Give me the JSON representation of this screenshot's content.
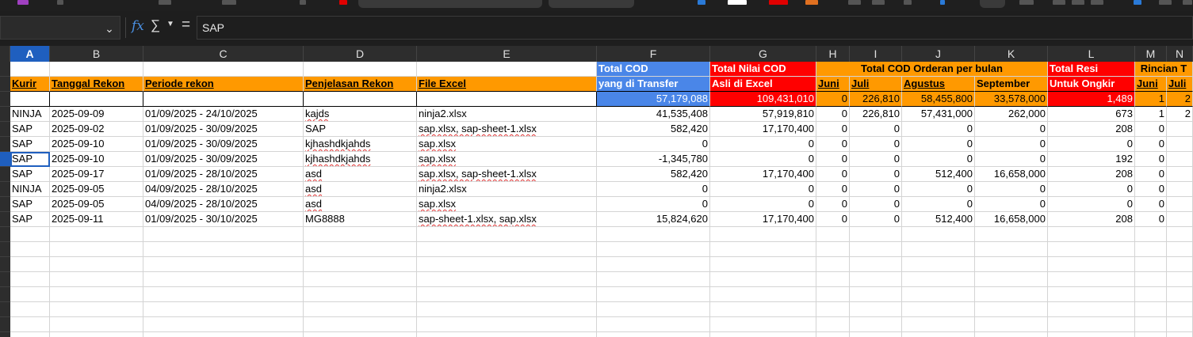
{
  "formula_bar": {
    "name_box_value": "",
    "formula_value": "SAP",
    "fx_icon": "fx-icon",
    "sum_icon": "sum-icon",
    "equals_icon": "equals-icon"
  },
  "columns": [
    "A",
    "B",
    "C",
    "D",
    "E",
    "F",
    "G",
    "H",
    "I",
    "J",
    "K",
    "L",
    "M",
    "N"
  ],
  "selected_column": "A",
  "header": {
    "row1": {
      "F": "Total COD",
      "G": "Total Nilai COD",
      "HK": "Total COD Orderan per bulan",
      "L": "Total Resi",
      "MN": "Rincian T"
    },
    "row2": {
      "A": "Kurir",
      "B": "Tanggal Rekon",
      "C": "Periode rekon",
      "D": "Penjelasan Rekon",
      "E": "File Excel",
      "F": "yang di Transfer",
      "G": "Asli di Excel",
      "H": "Juni",
      "I": "Juli",
      "J": "Agustus",
      "K": "September",
      "L": "Untuk Ongkir",
      "M": "Juni",
      "N": "Juli"
    }
  },
  "totals": {
    "F": "57,179,088",
    "G": "109,431,010",
    "H": "0",
    "I": "226,810",
    "J": "58,455,800",
    "K": "33,578,000",
    "L": "1,489",
    "M": "1",
    "N": "2"
  },
  "rows": [
    {
      "A": "NINJA",
      "B": "2025-09-09",
      "C": "01/09/2025 - 24/10/2025",
      "D": "kajds",
      "E": "ninja2.xlsx",
      "F": "41,535,408",
      "G": "57,919,810",
      "H": "0",
      "I": "226,810",
      "J": "57,431,000",
      "K": "262,000",
      "L": "673",
      "M": "1",
      "N": "2"
    },
    {
      "A": "SAP",
      "B": "2025-09-02",
      "C": "01/09/2025 - 30/09/2025",
      "D": "SAP",
      "E": "sap.xlsx, sap-sheet-1.xlsx",
      "F": "582,420",
      "G": "17,170,400",
      "H": "0",
      "I": "0",
      "J": "0",
      "K": "0",
      "L": "208",
      "M": "0",
      "N": ""
    },
    {
      "A": "SAP",
      "B": "2025-09-10",
      "C": "01/09/2025 - 30/09/2025",
      "D": "kjhashdkjahds",
      "E": "sap.xlsx",
      "F": "0",
      "G": "0",
      "H": "0",
      "I": "0",
      "J": "0",
      "K": "0",
      "L": "0",
      "M": "0",
      "N": ""
    },
    {
      "A": "SAP",
      "B": "2025-09-10",
      "C": "01/09/2025 - 30/09/2025",
      "D": "kjhashdkjahds",
      "E": "sap.xlsx",
      "F": "-1,345,780",
      "G": "0",
      "H": "0",
      "I": "0",
      "J": "0",
      "K": "0",
      "L": "192",
      "M": "0",
      "N": ""
    },
    {
      "A": "SAP",
      "B": "2025-09-17",
      "C": "01/09/2025 - 28/10/2025",
      "D": "asd",
      "E": "sap.xlsx, sap-sheet-1.xlsx",
      "F": "582,420",
      "G": "17,170,400",
      "H": "0",
      "I": "0",
      "J": "512,400",
      "K": "16,658,000",
      "L": "208",
      "M": "0",
      "N": ""
    },
    {
      "A": "NINJA",
      "B": "2025-09-05",
      "C": "04/09/2025 - 28/10/2025",
      "D": "asd",
      "E": "ninja2.xlsx",
      "F": "0",
      "G": "0",
      "H": "0",
      "I": "0",
      "J": "0",
      "K": "0",
      "L": "0",
      "M": "0",
      "N": ""
    },
    {
      "A": "SAP",
      "B": "2025-09-05",
      "C": "04/09/2025 - 28/10/2025",
      "D": "asd",
      "E": "sap.xlsx",
      "F": "0",
      "G": "0",
      "H": "0",
      "I": "0",
      "J": "0",
      "K": "0",
      "L": "0",
      "M": "0",
      "N": ""
    },
    {
      "A": "SAP",
      "B": "2025-09-11",
      "C": "01/09/2025 - 30/10/2025",
      "D": "MG8888",
      "E": "sap-sheet-1.xlsx, sap.xlsx",
      "F": "15,824,620",
      "G": "17,170,400",
      "H": "0",
      "I": "0",
      "J": "512,400",
      "K": "16,658,000",
      "L": "208",
      "M": "0",
      "N": ""
    }
  ],
  "colors": {
    "orange": "#ff9900",
    "blue": "#4a86e8",
    "red": "#ff0000",
    "selection": "#1f5fbf"
  }
}
